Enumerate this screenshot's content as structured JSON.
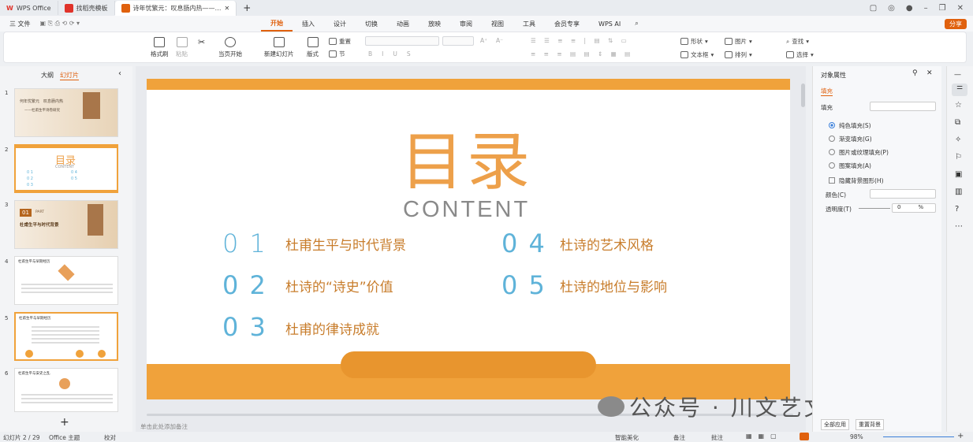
{
  "tabs": {
    "app": "WPS Office",
    "template": "找稻壳模板",
    "doc": "诗年忧繁元：叹息肠内热——…"
  },
  "menu": {
    "file": "三 文件",
    "items": [
      "开始",
      "插入",
      "设计",
      "切换",
      "动画",
      "放映",
      "审阅",
      "视图",
      "工具",
      "会员专享",
      "WPS AI"
    ],
    "share": "分享"
  },
  "ribbon": {
    "format_painter": "格式刷",
    "paste": "粘贴",
    "cut": "",
    "play_from": "当页开始",
    "new_slide": "新建幻灯片",
    "layout": "版式",
    "section": "节",
    "reset": "重置",
    "font_size_up": "A⁺",
    "font_size_down": "A⁻",
    "bold": "B",
    "italic": "I",
    "underline": "U",
    "strike": "S",
    "shape": "形状",
    "picture": "图片",
    "textbox": "文本框",
    "arrange": "排列",
    "find": "查找",
    "select": "选择"
  },
  "leftpanel": {
    "outline": "大纲",
    "slides": "幻灯片"
  },
  "thumbs": [
    {
      "n": "1",
      "line1": "何年忧繁元　叹息肠内热",
      "line2": "——杜甫生平诗卷研究"
    },
    {
      "n": "2",
      "title": "目录",
      "sub": "CONTENT"
    },
    {
      "n": "3",
      "part": "01",
      "label": "PART",
      "title": "杜甫生平与时代背景"
    },
    {
      "n": "4",
      "head": "杜甫生平与早期经历"
    },
    {
      "n": "5",
      "head": "杜甫生平与早期经历"
    },
    {
      "n": "6",
      "head": "杜甫生平与安史之乱"
    }
  ],
  "slide": {
    "title": "目录",
    "subtitle": "CONTENT",
    "items": [
      {
        "num": "0 1",
        "text": "杜甫生平与时代背景"
      },
      {
        "num": "0 2",
        "text": "杜诗的“诗史”价值"
      },
      {
        "num": "0 3",
        "text": "杜甫的律诗成就"
      },
      {
        "num": "0 4",
        "text": "杜诗的艺术风格"
      },
      {
        "num": "0 5",
        "text": "杜诗的地位与影响"
      }
    ]
  },
  "notes_placeholder": "单击此处添加备注",
  "rightpanel": {
    "title": "对象属性",
    "tab": "填充",
    "fill_label": "填充",
    "options": [
      "纯色填充(S)",
      "渐变填充(G)",
      "图片或纹理填充(P)",
      "图案填充(A)"
    ],
    "hide_bg": "隐藏背景图形(H)",
    "color_label": "颜色(C)",
    "transparency_label": "透明度(T)",
    "transparency_value": "0",
    "percent": "%",
    "apply_all": "全部应用",
    "reset_bg": "重置背景"
  },
  "watermark": "公众号 · 川文艺文旅范儿",
  "status": {
    "slide": "幻灯片 2 / 29",
    "theme": "Office 主题",
    "proofread": "校对",
    "smart": "智能美化",
    "notes": "备注",
    "comment": "批注",
    "zoom": "98%"
  },
  "colors": {
    "accent": "#f0a23b",
    "title": "#eda04a",
    "blue": "#5fb3d9",
    "text": "#c87d2c",
    "ribbon_active": "#e0610e"
  }
}
